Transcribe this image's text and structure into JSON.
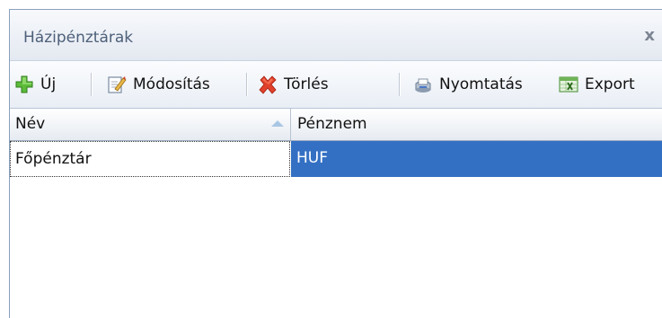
{
  "window": {
    "title": "Házipénztárak",
    "close_glyph": "x"
  },
  "toolbar": {
    "new_label": "Új",
    "edit_label": "Módosítás",
    "delete_label": "Törlés",
    "print_label": "Nyomtatás",
    "export_label": "Export",
    "icons": {
      "new": "plus-icon",
      "edit": "edit-icon",
      "delete": "delete-x-icon",
      "print": "printer-icon",
      "export": "excel-icon"
    }
  },
  "grid": {
    "columns": [
      "Név",
      "Pénznem"
    ],
    "sort": {
      "column": "Név",
      "direction": "ascending"
    },
    "rows": [
      {
        "nev": "Főpénztár",
        "penznem": "HUF",
        "selected": true
      }
    ]
  },
  "colors": {
    "selection": "#3370c4",
    "title_text": "#4d5f79",
    "border": "#8ba0bc"
  }
}
